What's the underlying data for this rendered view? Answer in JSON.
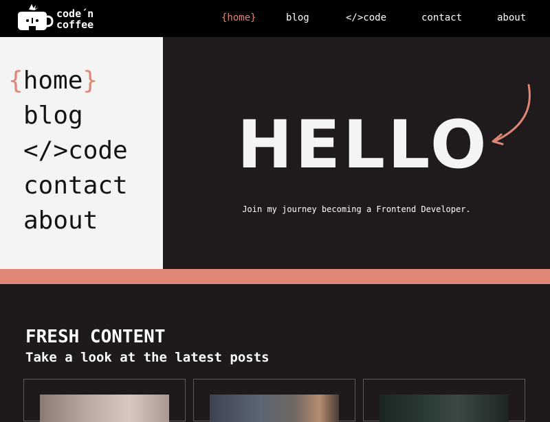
{
  "header": {
    "logo_text": "code´n\ncoffee",
    "nav": [
      {
        "label": "{home}",
        "active": true
      },
      {
        "label": "blog",
        "active": false
      },
      {
        "label": "</>code",
        "active": false
      },
      {
        "label": "contact",
        "active": false
      },
      {
        "label": "about",
        "active": false
      }
    ]
  },
  "hero": {
    "menu": {
      "open_brace": "{",
      "home": "home",
      "close_brace": "}",
      "blog": "blog",
      "code": "</>code",
      "contact": "contact",
      "about": "about"
    },
    "headline": "HELLO",
    "tagline": "Join my journey becoming a Frontend Developer."
  },
  "section": {
    "title": "FRESH CONTENT",
    "subtitle": "Take a look at the latest posts"
  },
  "colors": {
    "accent": "#df8777",
    "dark": "#1e1a1b",
    "light": "#f4f4f4"
  }
}
